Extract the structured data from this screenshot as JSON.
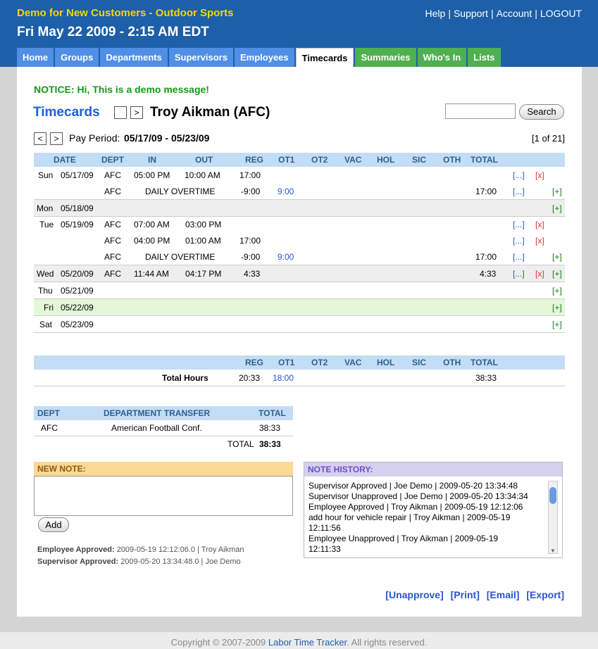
{
  "header": {
    "brand": "Demo for New Customers - Outdoor Sports",
    "datetime": "Fri May 22 2009 - 2:15 AM EDT",
    "links": [
      "Help",
      "Support",
      "Account",
      "LOGOUT"
    ]
  },
  "tabs": [
    "Home",
    "Groups",
    "Departments",
    "Supervisors",
    "Employees",
    "Timecards",
    "Summaries",
    "Who's In",
    "Lists"
  ],
  "notice": "NOTICE: Hi, This is a demo message!",
  "timecards_title": "Timecards",
  "next_arrow": ">",
  "employee": "Troy Aikman (AFC)",
  "search_label": "Search",
  "pay_period": {
    "prev": "<",
    "next": ">",
    "label": "Pay Period:",
    "value": "05/17/09 - 05/23/09",
    "pager": "[1 of 21]"
  },
  "columns": [
    "DATE",
    "DEPT",
    "IN",
    "OUT",
    "REG",
    "OT1",
    "OT2",
    "VAC",
    "HOL",
    "SIC",
    "OTH",
    "TOTAL"
  ],
  "rows": [
    {
      "day": "Sun",
      "date": "05/17/09",
      "dept": "AFC",
      "in": "05:00 PM",
      "out": "10:00 AM",
      "reg": "17:00",
      "ot1": "",
      "total": "",
      "edit": "[...]",
      "del": "[x]",
      "add": ""
    },
    {
      "day": "",
      "date": "",
      "dept": "AFC",
      "note": "DAILY OVERTIME",
      "reg": "-9:00",
      "ot1": "9:00",
      "total": "17:00",
      "edit": "[...]",
      "del": "",
      "add": "[+]"
    },
    {
      "day": "Mon",
      "date": "05/18/09",
      "add": "[+]"
    },
    {
      "day": "Tue",
      "date": "05/19/09",
      "dept": "AFC",
      "in": "07:00 AM",
      "out": "03:00 PM",
      "reg": "",
      "edit": "[...]",
      "del": "[x]"
    },
    {
      "day": "",
      "date": "",
      "dept": "AFC",
      "in": "04:00 PM",
      "out": "01:00 AM",
      "reg": "17:00",
      "edit": "[...]",
      "del": "[x]"
    },
    {
      "day": "",
      "date": "",
      "dept": "AFC",
      "note": "DAILY OVERTIME",
      "reg": "-9:00",
      "ot1": "9:00",
      "total": "17:00",
      "edit": "[...]",
      "add": "[+]"
    },
    {
      "day": "Wed",
      "date": "05/20/09",
      "dept": "AFC",
      "in": "11:44 AM",
      "out": "04:17 PM",
      "reg": "4:33",
      "total": "4:33",
      "edit": "[...]",
      "del": "[x]",
      "add": "[+]"
    },
    {
      "day": "Thu",
      "date": "05/21/09",
      "add": "[+]"
    },
    {
      "day": "Fri",
      "date": "05/22/09",
      "add": "[+]"
    },
    {
      "day": "Sat",
      "date": "05/23/09",
      "add": "[+]"
    }
  ],
  "totals": {
    "label": "Total Hours",
    "reg": "20:33",
    "ot1": "18:00",
    "total": "38:33"
  },
  "dept_transfer": {
    "headers": [
      "DEPT",
      "DEPARTMENT TRANSFER",
      "TOTAL"
    ],
    "rows": [
      {
        "dept": "AFC",
        "name": "American Football Conf.",
        "total": "38:33"
      }
    ],
    "total_label": "TOTAL",
    "total_value": "38:33"
  },
  "new_note": {
    "header": "NEW NOTE:",
    "add_label": "Add"
  },
  "approvals": {
    "employee_label": "Employee Approved:",
    "employee_value": "2009-05-19 12:12:06.0 | Troy Aikman",
    "supervisor_label": "Supervisor Approved:",
    "supervisor_value": "2009-05-20 13:34:48.0 | Joe Demo"
  },
  "note_history": {
    "header": "NOTE HISTORY:",
    "lines": [
      "Supervisor Approved | Joe Demo | 2009-05-20 13:34:48",
      "Supervisor Unapproved | Joe Demo | 2009-05-20 13:34:34",
      "Employee Approved | Troy Aikman | 2009-05-19 12:12:06",
      "add hour for vehicle repair | Troy Aikman | 2009-05-19",
      "12:11:56",
      "Employee Unapproved | Troy Aikman | 2009-05-19",
      "12:11:33"
    ]
  },
  "actions": [
    "[Unapprove]",
    "[Print]",
    "[Email]",
    "[Export]"
  ],
  "footer": {
    "prefix": "Copyright © 2007-2009",
    "link": "Labor Time Tracker",
    "suffix": ". All rights reserved."
  }
}
